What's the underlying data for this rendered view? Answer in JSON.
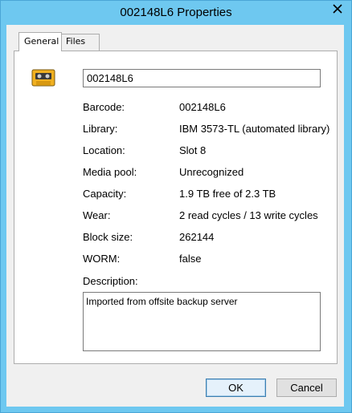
{
  "window": {
    "title": "002148L6 Properties",
    "close_icon": "close-icon"
  },
  "tabs": [
    {
      "label": "General",
      "active": true
    },
    {
      "label": "Files",
      "active": false
    }
  ],
  "general": {
    "icon": "tape-cartridge-icon",
    "name_value": "002148L6",
    "properties": [
      {
        "label": "Barcode:",
        "value": "002148L6"
      },
      {
        "label": "Library:",
        "value": "IBM 3573-TL (automated library)"
      },
      {
        "label": "Location:",
        "value": "Slot 8"
      },
      {
        "label": "Media pool:",
        "value": "Unrecognized"
      },
      {
        "label": "Capacity:",
        "value": "1.9 TB free of 2.3 TB"
      },
      {
        "label": "Wear:",
        "value": "2 read cycles / 13 write cycles"
      },
      {
        "label": "Block size:",
        "value": "262144"
      },
      {
        "label": "WORM:",
        "value": "false"
      }
    ],
    "description_label": "Description:",
    "description_value": "Imported from offsite backup server"
  },
  "buttons": {
    "ok_label": "OK",
    "cancel_label": "Cancel"
  },
  "colors": {
    "frame": "#6ec8f0",
    "tape_body": "#f0b020"
  }
}
